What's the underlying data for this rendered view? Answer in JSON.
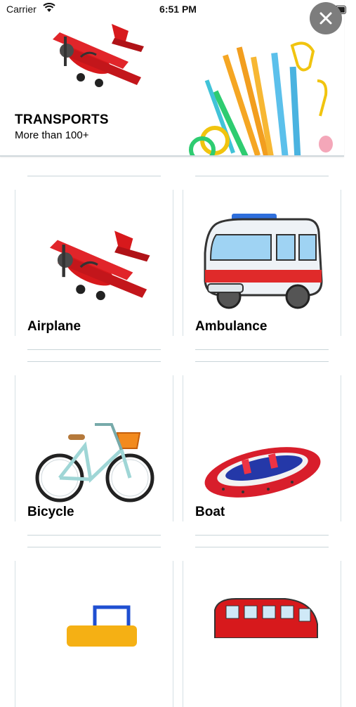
{
  "status_bar": {
    "carrier": "Carrier",
    "time": "6:51 PM"
  },
  "header": {
    "title": "TRANSPORTS",
    "subtitle": "More than 100+"
  },
  "items": [
    {
      "label": "Airplane",
      "icon": "airplane-icon"
    },
    {
      "label": "Ambulance",
      "icon": "ambulance-icon"
    },
    {
      "label": "Bicycle",
      "icon": "bicycle-icon"
    },
    {
      "label": "Boat",
      "icon": "boat-icon"
    },
    {
      "label": "",
      "icon": "road-roller-icon"
    },
    {
      "label": "",
      "icon": "bus-icon"
    }
  ],
  "colors": {
    "accent_red": "#d7191c",
    "line": "#c9d5d9",
    "close_bg": "#7d7d7d"
  }
}
